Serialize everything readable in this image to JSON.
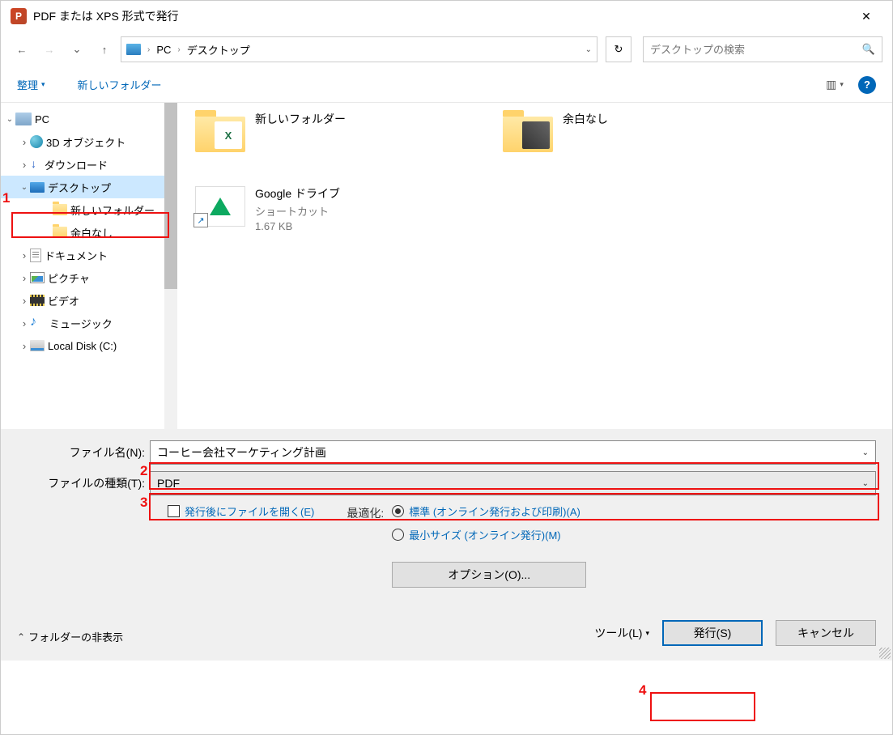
{
  "window": {
    "app_icon_letter": "P",
    "title": "PDF または XPS 形式で発行",
    "close": "✕"
  },
  "nav": {
    "back": "←",
    "forward": "→",
    "up": "↑",
    "breadcrumb": {
      "root": "PC",
      "sep1": "›",
      "current": "デスクトップ",
      "dd": "⌄"
    },
    "refresh": "↻",
    "search_placeholder": "デスクトップの検索",
    "search_icon": "🔍"
  },
  "toolbar": {
    "organize": "整理",
    "newfolder": "新しいフォルダー",
    "view_icon": "▥",
    "view_dd": "▾",
    "help": "?"
  },
  "tree": {
    "pc": "PC",
    "objects3d": "3D オブジェクト",
    "downloads": "ダウンロード",
    "desktop": "デスクトップ",
    "newfolder": "新しいフォルダー",
    "nomargin": "余白なし",
    "documents": "ドキュメント",
    "pictures": "ピクチャ",
    "videos": "ビデオ",
    "music": "ミュージック",
    "localdisk": "Local Disk (C:)"
  },
  "items": {
    "newfolder": {
      "name": "新しいフォルダー"
    },
    "nomargin": {
      "name": "余白なし"
    },
    "gdrive": {
      "name": "Google ドライブ",
      "type": "ショートカット",
      "size": "1.67 KB"
    }
  },
  "bottom": {
    "filename_label": "ファイル名(N):",
    "filename_value": "コーヒー会社マーケティング計画",
    "filetype_label": "ファイルの種類(T):",
    "filetype_value": "PDF",
    "open_after": "発行後にファイルを開く(E)",
    "optimize_label": "最適化:",
    "opt_standard": "標準 (オンライン発行および印刷)(A)",
    "opt_min": "最小サイズ (オンライン発行)(M)",
    "options_btn": "オプション(O)...",
    "hide_folders": "フォルダーの非表示",
    "tools": "ツール(L)",
    "publish": "発行(S)",
    "cancel": "キャンセル"
  },
  "annot": {
    "n1": "1",
    "n2": "2",
    "n3": "3",
    "n4": "4"
  }
}
